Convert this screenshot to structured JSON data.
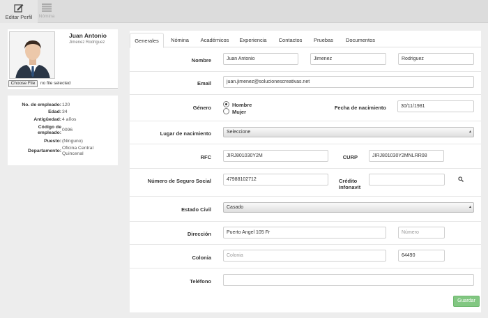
{
  "toolbar": {
    "edit_profile_label": "Editar Perfil",
    "edit_profile_icon": "edit-icon",
    "nomina_label": "Nómina",
    "nomina_icon": "list-icon"
  },
  "profile": {
    "name": "Juan Antonio",
    "surnames": "Jimenez Rodriguez",
    "file_button": "Choose File",
    "file_status": "no file selected"
  },
  "info": [
    {
      "label": "No. de empleado:",
      "value": "120"
    },
    {
      "label": "Edad:",
      "value": "34"
    },
    {
      "label": "Antigüedad:",
      "value": "4 años"
    },
    {
      "label": "Código de empleado:",
      "value": "0096"
    },
    {
      "label": "Puesto:",
      "value": "(Ninguno)"
    },
    {
      "label": "Departamento:",
      "value": "Oficina Central Quincenal"
    }
  ],
  "tabs": [
    "Generales",
    "Nómina",
    "Académicos",
    "Experiencia",
    "Contactos",
    "Pruebas",
    "Documentos"
  ],
  "active_tab": "Generales",
  "form": {
    "nombre_label": "Nombre",
    "nombre": "Juan Antonio",
    "apellido_paterno": "Jimenez",
    "apellido_materno": "Rodriguez",
    "email_label": "Email",
    "email": "juan.jimenez@solucionescreativas.net",
    "genero_label": "Género",
    "genero_hombre": "Hombre",
    "genero_mujer": "Mujer",
    "fecha_label": "Fecha de nacimiento",
    "fecha": "30/11/1981",
    "lugar_label": "Lugar de nacimiento",
    "lugar": "Seleccione",
    "rfc_label": "RFC",
    "rfc": "JIRJ801030Y2M",
    "curp_label": "CURP",
    "curp": "JIRJ801030Y2MNLRR08",
    "nss_label": "Número de Seguro Social",
    "nss": "47988102712",
    "infonavit_label": "Crédito Infonavit",
    "infonavit": "",
    "estado_civil_label": "Estado Civil",
    "estado_civil": "Casado",
    "direccion_label": "Dirección",
    "direccion": "Puerto Angel 105 Fr",
    "numero_placeholder": "Número",
    "colonia_label": "Colonia",
    "colonia_placeholder": "Colonia",
    "cp": "64490",
    "telefono_label": "Teléfono",
    "telefono": "",
    "save_label": "Guardar"
  },
  "colors": {
    "save_button": "#82c782",
    "toolbar_bg": "#dcdcdc",
    "page_bg": "#ededed"
  }
}
